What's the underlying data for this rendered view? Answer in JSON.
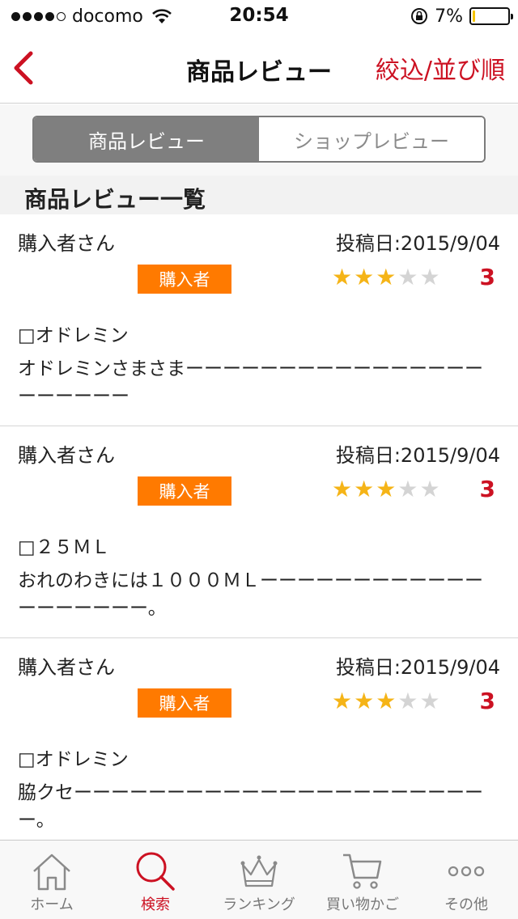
{
  "status_bar": {
    "carrier": "docomo",
    "time": "20:54",
    "battery_percent": "7%",
    "battery_level": 0.07,
    "signal_bars": 4
  },
  "nav": {
    "title": "商品レビュー",
    "action": "絞込/並び順",
    "accent_color": "#cc1122"
  },
  "segment": {
    "tabs": [
      {
        "label": "商品レビュー",
        "selected": true
      },
      {
        "label": "ショップレビュー",
        "selected": false
      }
    ]
  },
  "section": {
    "title": "商品レビュー一覧"
  },
  "reviews": [
    {
      "reviewer": "購入者さん",
      "date": "投稿日:2015/9/04",
      "badge": "購入者",
      "rating": 3,
      "score": "3",
      "title": "□オドレミン",
      "body": "オドレミンさまさまーーーーーーーーーーーーーーーーーーーーーー"
    },
    {
      "reviewer": "購入者さん",
      "date": "投稿日:2015/9/04",
      "badge": "購入者",
      "rating": 3,
      "score": "3",
      "title": "□２５ＭＬ",
      "body": "おれのわきには１０００ＭＬーーーーーーーーーーーーーーーーーーー。"
    },
    {
      "reviewer": "購入者さん",
      "date": "投稿日:2015/9/04",
      "badge": "購入者",
      "rating": 3,
      "score": "3",
      "title": "□オドレミン",
      "body": "脇クセーーーーーーーーーーーーーーーーーーーーーーー。"
    }
  ],
  "tab_bar": {
    "tabs": [
      {
        "label": "ホーム",
        "icon": "home-icon"
      },
      {
        "label": "検索",
        "icon": "search-icon",
        "active": true
      },
      {
        "label": "ランキング",
        "icon": "crown-icon"
      },
      {
        "label": "買い物かご",
        "icon": "cart-icon"
      },
      {
        "label": "その他",
        "icon": "more-icon"
      }
    ]
  }
}
